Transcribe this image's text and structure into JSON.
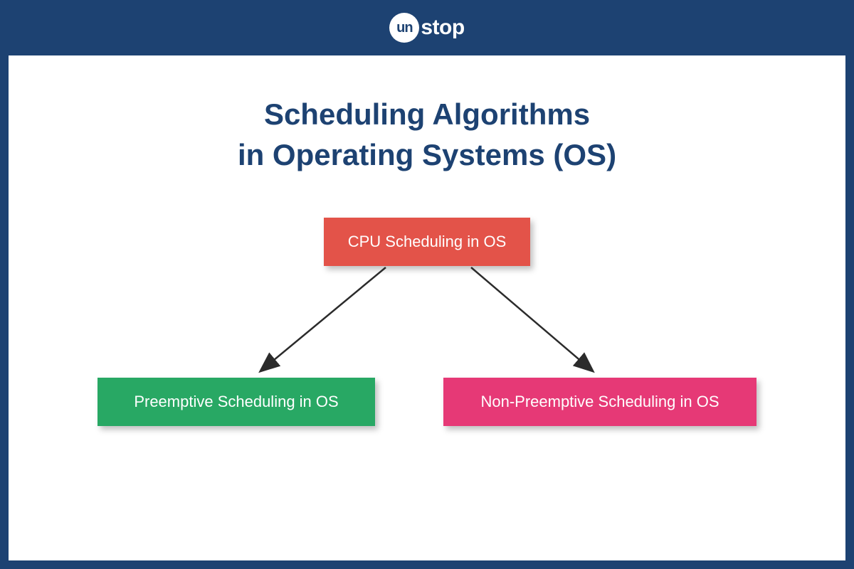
{
  "logo": {
    "circle_text": "un",
    "suffix_text": "stop"
  },
  "title": {
    "line1": "Scheduling Algorithms",
    "line2": "in Operating Systems (OS)"
  },
  "diagram": {
    "root": {
      "label": "CPU Scheduling in OS",
      "color": "#e35349"
    },
    "children": [
      {
        "label": "Preemptive Scheduling in OS",
        "color": "#28a864"
      },
      {
        "label": "Non-Preemptive Scheduling in OS",
        "color": "#e63976"
      }
    ]
  }
}
